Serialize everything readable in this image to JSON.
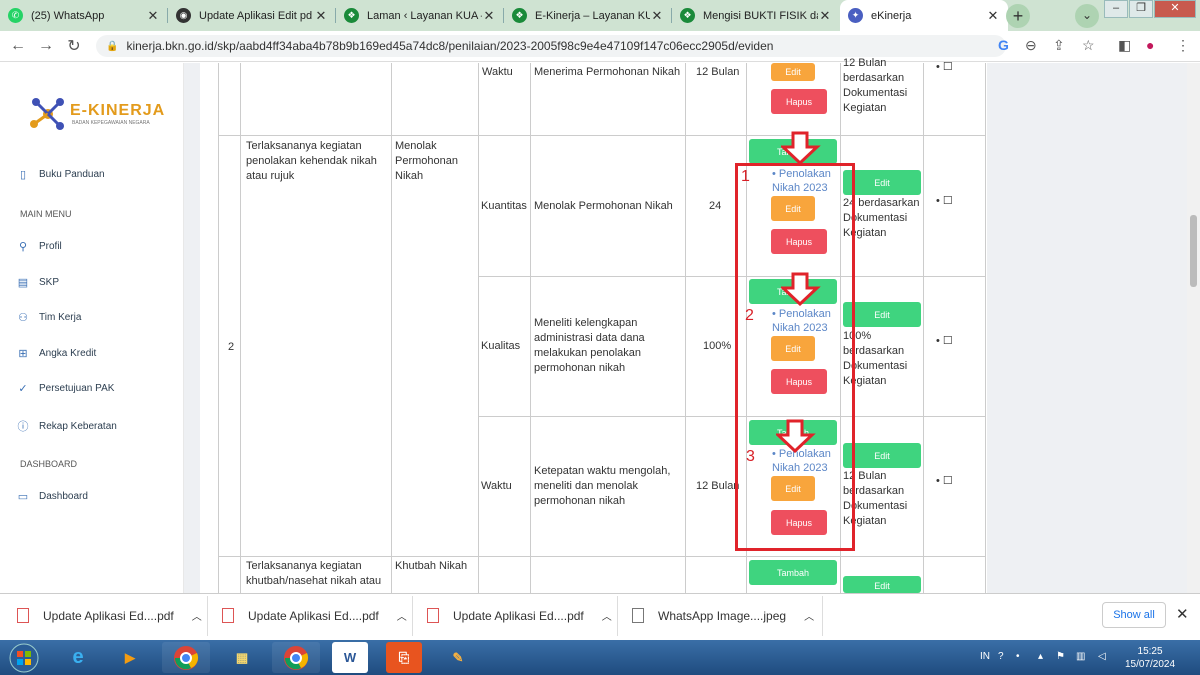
{
  "tabs": [
    {
      "title": "(25) WhatsApp",
      "icon": "whatsapp-icon",
      "color": "#25d366"
    },
    {
      "title": "Update Aplikasi Edit pd",
      "icon": "globe-icon",
      "color": "#333333"
    },
    {
      "title": "Laman ‹ Layanan KUA –",
      "icon": "kemenag-icon",
      "color": "#1a8a3a"
    },
    {
      "title": "E-Kinerja – Layanan KUA",
      "icon": "kemenag-icon",
      "color": "#1a8a3a"
    },
    {
      "title": "Mengisi BUKTI FISIK dan",
      "icon": "kemenag-icon",
      "color": "#1a8a3a"
    },
    {
      "title": "eKinerja",
      "icon": "ekinerja-icon",
      "color": "#4a5fc1"
    }
  ],
  "url": "kinerja.bkn.go.id/skp/aabd4ff34aba4b78b9b169ed45a74dc8/penilaian/2023-2005f98c9e4e47109f147c06ecc2905d/eviden",
  "logo": {
    "title": "E-KINERJA",
    "subtitle": "BADAN KEPEGAWAIAN NEGARA"
  },
  "sidebar": {
    "items": [
      {
        "label": "Buku Panduan",
        "icon": "book-icon"
      },
      {
        "label": "Profil",
        "icon": "user-icon"
      },
      {
        "label": "SKP",
        "icon": "document-icon"
      },
      {
        "label": "Tim Kerja",
        "icon": "users-icon"
      },
      {
        "label": "Angka Kredit",
        "icon": "file-plus-icon"
      },
      {
        "label": "Persetujuan PAK",
        "icon": "check-circle-icon"
      },
      {
        "label": "Rekap Keberatan",
        "icon": "info-icon"
      },
      {
        "label": "Dashboard",
        "icon": "monitor-icon"
      }
    ],
    "main_menu_heading": "MAIN MENU",
    "dashboard_heading": "DASHBOARD"
  },
  "table": {
    "row_number": "2",
    "top_row": {
      "aspect": "Waktu",
      "indicator": "Menerima Permohonan Nikah",
      "target": "12 Bulan",
      "edit": "Edit",
      "hapus": "Hapus",
      "realisasi": "12 Bulan berdasarkan Dokumentasi Kegiatan"
    },
    "group": {
      "rencana": "Terlaksananya kegiatan penolakan kehendak nikah atau rujuk",
      "kegiatan": "Menolak Permohonan Nikah",
      "rows": [
        {
          "aspect": "Kuantitas",
          "indicator": "Menolak Permohonan Nikah",
          "target": "24",
          "tambah": "Tambah",
          "link": "Penolakan Nikah 2023",
          "edit": "Edit",
          "hapus": "Hapus",
          "edit2": "Edit",
          "realisasi": "24 berdasarkan Dokumentasi Kegiatan",
          "marker": "1"
        },
        {
          "aspect": "Kualitas",
          "indicator": "Meneliti kelengkapan administrasi data dana melakukan penolakan permohonan nikah",
          "target": "100%",
          "tambah": "Tambah",
          "link": "Penolakan Nikah 2023",
          "edit": "Edit",
          "hapus": "Hapus",
          "edit2": "Edit",
          "realisasi": "100% berdasarkan Dokumentasi Kegiatan",
          "marker": "2"
        },
        {
          "aspect": "Waktu",
          "indicator": "Ketepatan waktu mengolah, meneliti dan menolak permohonan nikah",
          "target": "12 Bulan",
          "tambah": "Tambah",
          "link": "Penolakan Nikah 2023",
          "edit": "Edit",
          "hapus": "Hapus",
          "edit2": "Edit",
          "realisasi": "12 Bulan berdasarkan Dokumentasi Kegiatan",
          "marker": "3"
        }
      ]
    },
    "next_row": {
      "rencana": "Terlaksananya kegiatan khutbah/nasehat nikah atau",
      "kegiatan": "Khutbah Nikah",
      "tambah": "Tambah",
      "edit": "Edit"
    },
    "bullet": "•",
    "checkbox": "☐"
  },
  "downloads": {
    "items": [
      {
        "name": "Update Aplikasi Ed....pdf",
        "icon": "pdf-icon"
      },
      {
        "name": "Update Aplikasi Ed....pdf",
        "icon": "pdf-icon"
      },
      {
        "name": "Update Aplikasi Ed....pdf",
        "icon": "pdf-icon"
      },
      {
        "name": "WhatsApp Image....jpeg",
        "icon": "image-icon"
      }
    ],
    "show_all": "Show all"
  },
  "taskbar": {
    "lang": "IN",
    "time": "15:25",
    "date": "15/07/2024"
  },
  "accent": {
    "green": "#3fd47f",
    "orange": "#f8a53c",
    "red": "#ee4f5e",
    "annotation": "#e0232a"
  }
}
